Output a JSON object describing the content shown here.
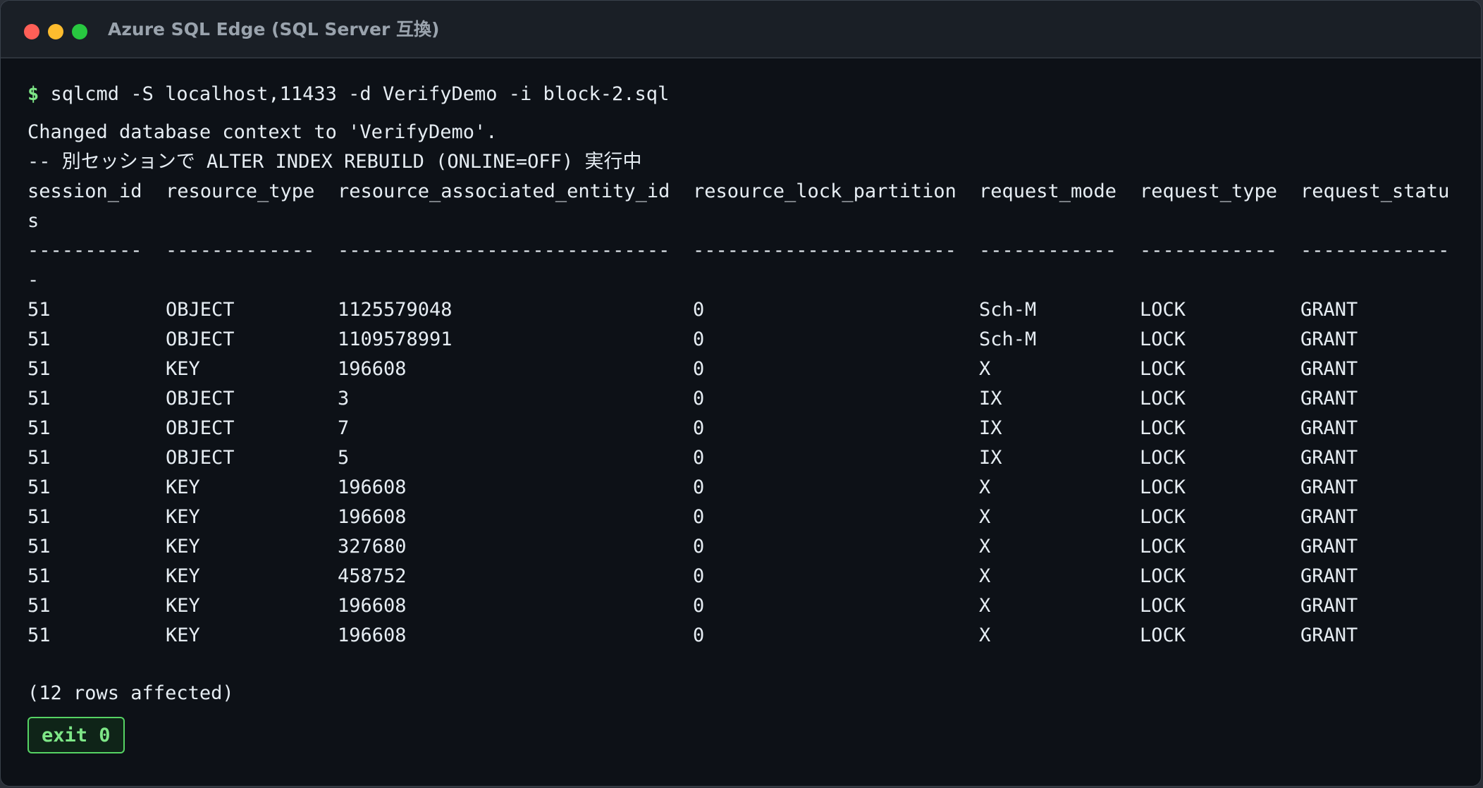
{
  "window": {
    "title": "Azure SQL Edge (SQL Server 互換)"
  },
  "terminal": {
    "prompt_symbol": "$",
    "command": "sqlcmd -S localhost,11433 -d VerifyDemo -i block-2.sql",
    "output_lines": [
      "Changed database context to 'VerifyDemo'.",
      "-- 別セッションで ALTER INDEX REBUILD (ONLINE=OFF) 実行中"
    ],
    "headers": [
      "session_id",
      "resource_type",
      "resource_associated_entity_id",
      "resource_lock_partition",
      "request_mode",
      "request_type",
      "request_statu"
    ],
    "header_wrap": "s",
    "separators": [
      "----------",
      "-------------",
      "-----------------------------",
      "-----------------------",
      "------------",
      "------------",
      "-------------"
    ],
    "separator_wrap": "-",
    "rows": [
      [
        "51",
        "OBJECT",
        "1125579048",
        "0",
        "Sch-M",
        "LOCK",
        "GRANT"
      ],
      [
        "51",
        "OBJECT",
        "1109578991",
        "0",
        "Sch-M",
        "LOCK",
        "GRANT"
      ],
      [
        "51",
        "KEY",
        "196608",
        "0",
        "X",
        "LOCK",
        "GRANT"
      ],
      [
        "51",
        "OBJECT",
        "3",
        "0",
        "IX",
        "LOCK",
        "GRANT"
      ],
      [
        "51",
        "OBJECT",
        "7",
        "0",
        "IX",
        "LOCK",
        "GRANT"
      ],
      [
        "51",
        "OBJECT",
        "5",
        "0",
        "IX",
        "LOCK",
        "GRANT"
      ],
      [
        "51",
        "KEY",
        "196608",
        "0",
        "X",
        "LOCK",
        "GRANT"
      ],
      [
        "51",
        "KEY",
        "196608",
        "0",
        "X",
        "LOCK",
        "GRANT"
      ],
      [
        "51",
        "KEY",
        "327680",
        "0",
        "X",
        "LOCK",
        "GRANT"
      ],
      [
        "51",
        "KEY",
        "458752",
        "0",
        "X",
        "LOCK",
        "GRANT"
      ],
      [
        "51",
        "KEY",
        "196608",
        "0",
        "X",
        "LOCK",
        "GRANT"
      ],
      [
        "51",
        "KEY",
        "196608",
        "0",
        "X",
        "LOCK",
        "GRANT"
      ]
    ],
    "rows_affected": "(12 rows affected)",
    "exit_label": "exit 0"
  },
  "colors": {
    "background": "#0d1117",
    "titlebar": "#1a1f26",
    "text": "#e6edf3",
    "prompt": "#7ee787",
    "exit_border": "#56d364",
    "close_light": "#ff5f57",
    "minimize_light": "#febc2e",
    "zoom_light": "#28c840"
  },
  "icons": {
    "close": "close-traffic-light-icon",
    "minimize": "minimize-traffic-light-icon",
    "zoom": "zoom-traffic-light-icon"
  }
}
